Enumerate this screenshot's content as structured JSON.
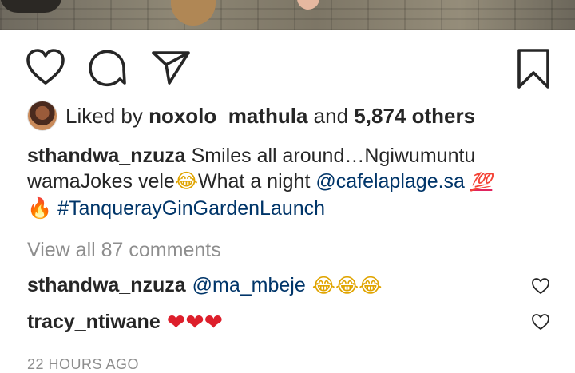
{
  "post": {
    "liked_by_prefix": "Liked by",
    "liked_by_user": "noxolo_mathula",
    "and_text": "and",
    "others_count": "5,874 others",
    "caption": {
      "username": "sthandwa_nzuza",
      "text_part1": "Smiles all around…Ngiwumuntu wamaJokes vele",
      "emoji_laugh": "😂",
      "text_part2": "What a night",
      "mention": "@cafelaplage.sa",
      "emoji_hundred": "💯",
      "emoji_fire": "🔥",
      "hashtag": "#TanquerayGinGardenLaunch"
    },
    "view_all_comments": "View all 87 comments",
    "comments": [
      {
        "username": "sthandwa_nzuza",
        "mention": "@ma_mbeje",
        "emojis": "😂😂😂"
      },
      {
        "username": "tracy_ntiwane",
        "emojis": "❤❤❤"
      }
    ],
    "timestamp": "22 HOURS AGO"
  },
  "icons": {
    "like": "heart-icon",
    "comment": "comment-icon",
    "share": "send-icon",
    "save": "bookmark-icon",
    "comment_like": "heart-outline-icon"
  },
  "colors": {
    "text": "#262626",
    "link": "#003569",
    "muted": "#8e8e8e",
    "heart_red": "#dd1f2b"
  }
}
